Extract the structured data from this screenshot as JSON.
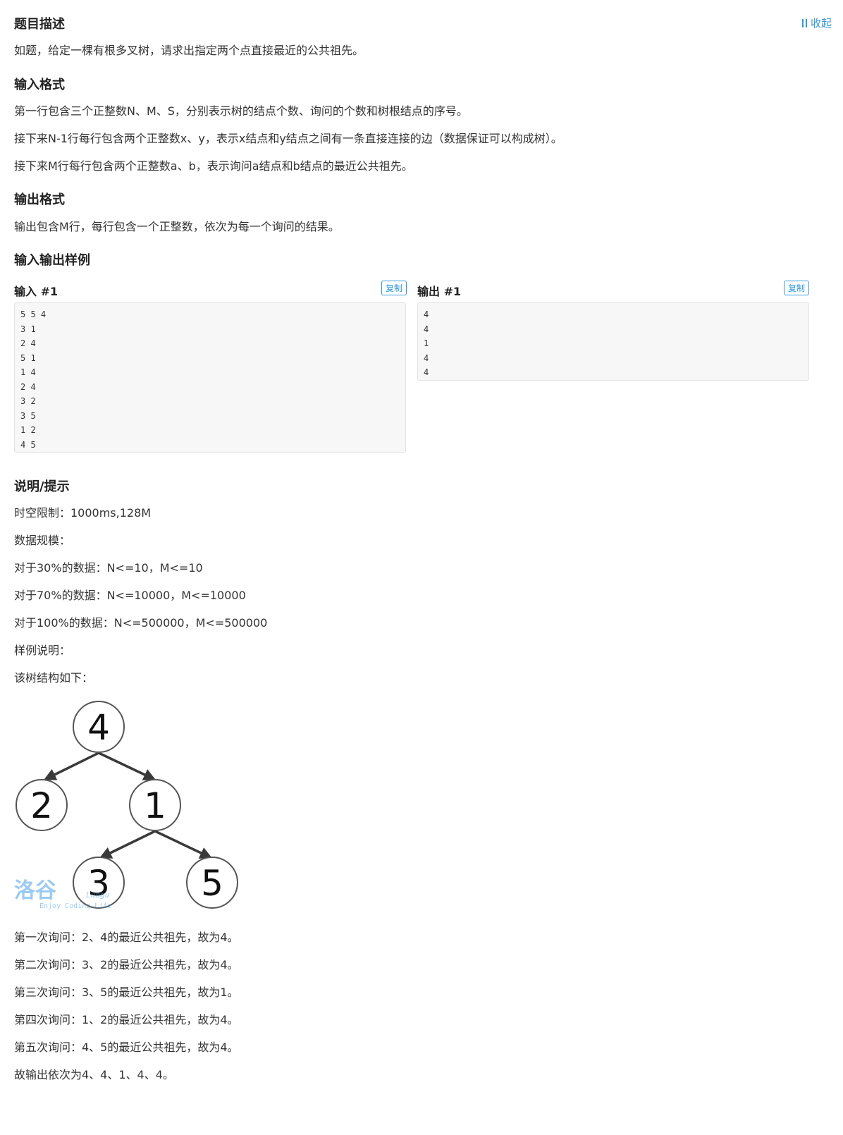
{
  "header": {
    "title": "题目描述",
    "collapse_label": "收起"
  },
  "description": "如题，给定一棵有根多叉树，请求出指定两个点直接最近的公共祖先。",
  "input_format": {
    "title": "输入格式",
    "lines": [
      "第一行包含三个正整数N、M、S，分别表示树的结点个数、询问的个数和树根结点的序号。",
      "接下来N-1行每行包含两个正整数x、y，表示x结点和y结点之间有一条直接连接的边（数据保证可以构成树）。",
      "接下来M行每行包含两个正整数a、b，表示询问a结点和b结点的最近公共祖先。"
    ]
  },
  "output_format": {
    "title": "输出格式",
    "lines": [
      "输出包含M行，每行包含一个正整数，依次为每一个询问的结果。"
    ]
  },
  "samples": {
    "title": "输入输出样例",
    "input": {
      "label": "输入 #1",
      "copy": "复制",
      "lines": [
        "5 5 4",
        "3 1",
        "2 4",
        "5 1",
        "1 4",
        "2 4",
        "3 2",
        "3 5",
        "1 2",
        "4 5"
      ]
    },
    "output": {
      "label": "输出 #1",
      "copy": "复制",
      "lines": [
        "4",
        "4",
        "1",
        "4",
        "4"
      ]
    }
  },
  "hint": {
    "title": "说明/提示",
    "lines": [
      "时空限制：1000ms,128M",
      "数据规模：",
      "对于30%的数据：N<=10，M<=10",
      "对于70%的数据：N<=10000，M<=10000",
      "对于100%的数据：N<=500000，M<=500000",
      "样例说明：",
      "该树结构如下："
    ],
    "after": [
      "第一次询问：2、4的最近公共祖先，故为4。",
      "第二次询问：3、2的最近公共祖先，故为4。",
      "第三次询问：3、5的最近公共祖先，故为1。",
      "第四次询问：1、2的最近公共祖先，故为4。",
      "第五次询问：4、5的最近公共祖先，故为4。",
      "故输出依次为4、4、1、4、4。"
    ]
  },
  "tree": {
    "nodes": [
      "4",
      "2",
      "1",
      "3",
      "5"
    ],
    "edges": [
      [
        "4",
        "2"
      ],
      [
        "4",
        "1"
      ],
      [
        "1",
        "3"
      ],
      [
        "1",
        "5"
      ]
    ]
  },
  "watermark": {
    "brand": "洛谷",
    "sub": "Luogu",
    "slogan": "Enjoy Coding Life"
  }
}
